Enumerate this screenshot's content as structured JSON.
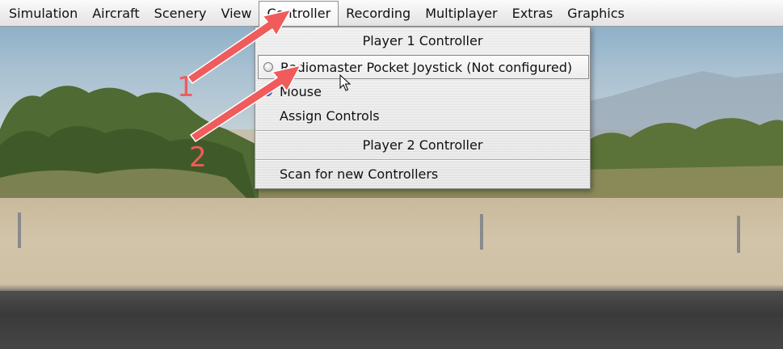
{
  "menubar": {
    "items": [
      {
        "label": "Simulation"
      },
      {
        "label": "Aircraft"
      },
      {
        "label": "Scenery"
      },
      {
        "label": "View"
      },
      {
        "label": "Controller",
        "active": true
      },
      {
        "label": "Recording"
      },
      {
        "label": "Multiplayer"
      },
      {
        "label": "Extras"
      },
      {
        "label": "Graphics"
      }
    ]
  },
  "controller_menu": {
    "player1_header": "Player 1 Controller",
    "joystick_option": "Radiomaster Pocket Joystick (Not configured)",
    "joystick_selected": false,
    "mouse_option": "Mouse",
    "mouse_selected": true,
    "assign_controls": "Assign Controls",
    "player2_header": "Player 2 Controller",
    "scan_controllers": "Scan for new Controllers"
  },
  "annotations": {
    "step1_label": "1",
    "step2_label": "2",
    "color": "#f05b5b"
  }
}
